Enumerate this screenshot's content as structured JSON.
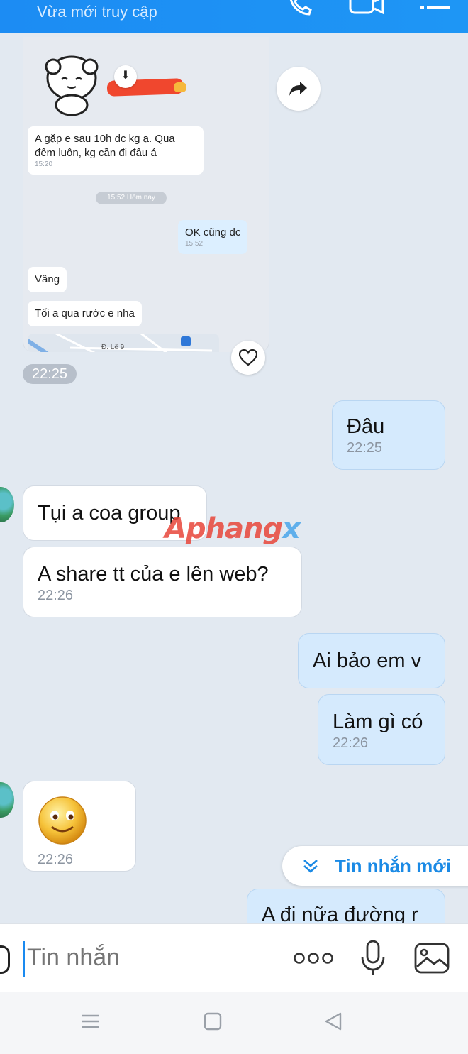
{
  "header": {
    "status": "Vừa mới truy cập",
    "icons": [
      "phone-icon",
      "video-icon",
      "menu-icon"
    ]
  },
  "forwarded": {
    "msg1_text": "A gặp e sau 10h dc kg ạ. Qua đêm luôn, kg cần đi đâu á",
    "msg1_time": "15:20",
    "separator": "15:52 Hôm nay",
    "msg2_text": "OK cũng đc",
    "msg2_time": "15:52",
    "msg3_text": "Vâng",
    "msg4_text": "Tối a qua rước e nha",
    "map_label": "Đ. Lê 9"
  },
  "time_pill": "22:25",
  "messages": [
    {
      "dir": "out",
      "text": "Đâu",
      "time": "22:25"
    },
    {
      "dir": "in",
      "text": "Tụi a coa group",
      "time": ""
    },
    {
      "dir": "in",
      "text": "A share tt của e lên web?",
      "time": "22:26"
    },
    {
      "dir": "out",
      "text": "Ai bảo em v",
      "time": ""
    },
    {
      "dir": "out",
      "text": "Làm gì có",
      "time": "22:26"
    },
    {
      "dir": "in",
      "text": "",
      "time": "22:26"
    },
    {
      "dir": "out",
      "text": "A đi nữa đường r",
      "time": ""
    }
  ],
  "watermark": {
    "part1": "Aphang",
    "part2": "x"
  },
  "new_messages_label": "Tin nhắn mới",
  "input": {
    "placeholder": "Tin nhắn"
  },
  "accent": "#1b8ae5"
}
